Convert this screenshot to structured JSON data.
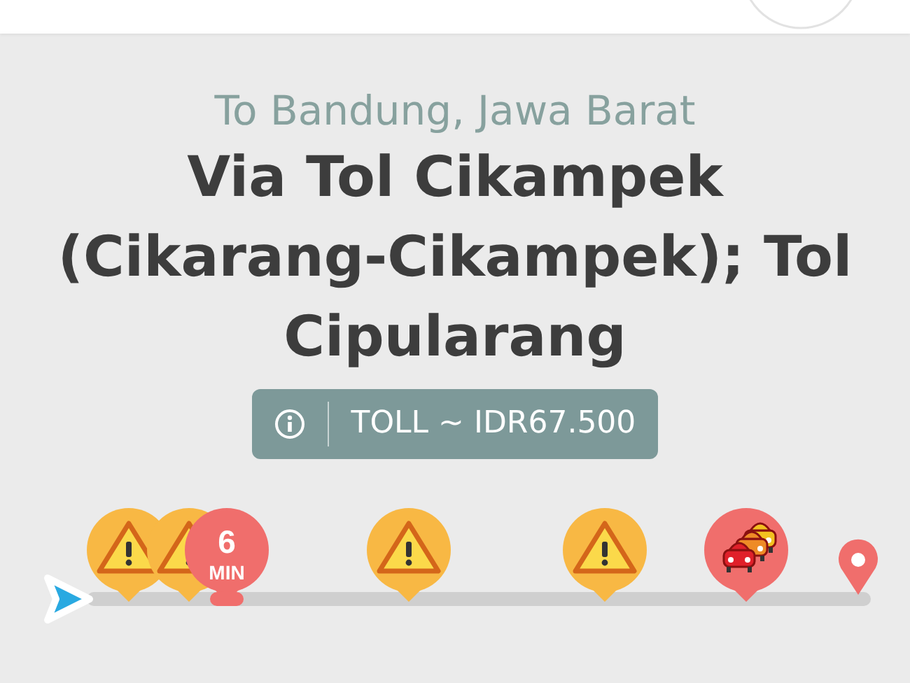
{
  "destination": "To Bandung, Jawa Barat",
  "route": "Via Tol Cikampek (Cikarang-Cikampek); Tol Cipularang",
  "toll": {
    "label": "TOLL ~ IDR67.500"
  },
  "route_bar": {
    "markers": [
      {
        "kind": "hazard"
      },
      {
        "kind": "hazard"
      },
      {
        "kind": "delay",
        "value": "6",
        "unit": "MIN"
      },
      {
        "kind": "hazard"
      },
      {
        "kind": "hazard"
      },
      {
        "kind": "traffic"
      },
      {
        "kind": "destination"
      }
    ]
  }
}
